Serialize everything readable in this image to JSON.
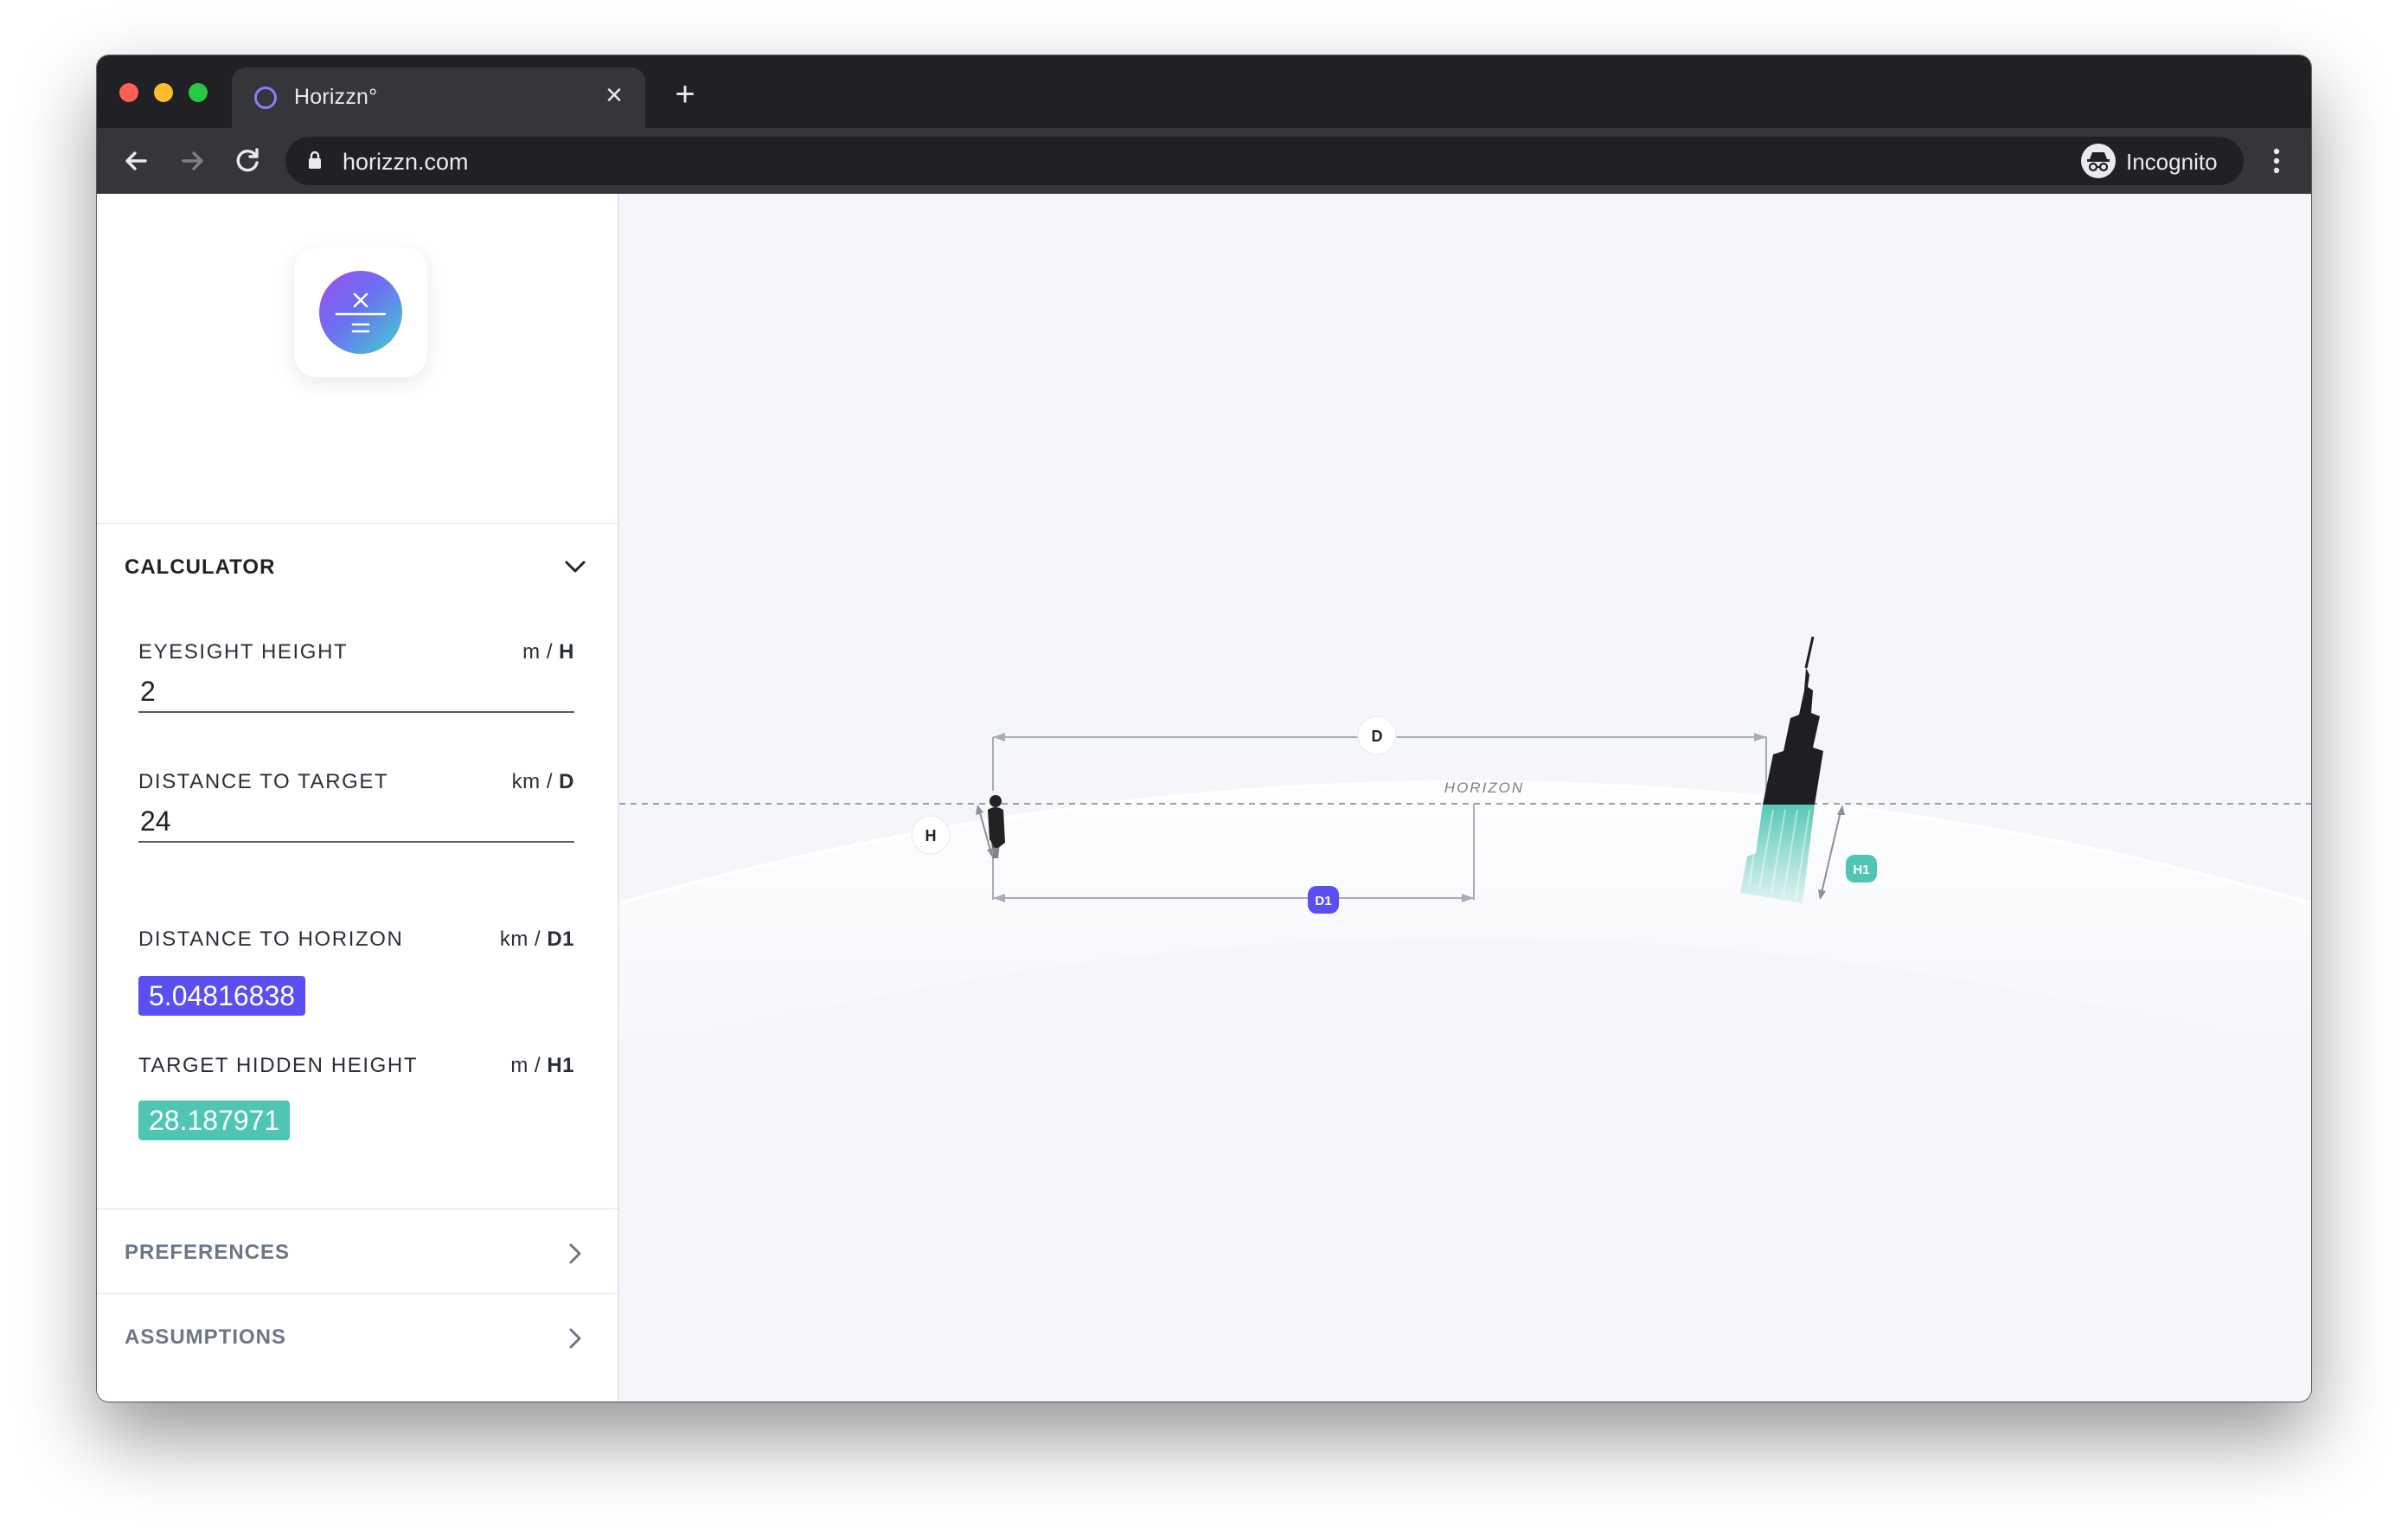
{
  "browser": {
    "tab_title": "Horizzn°",
    "url": "horizzn.com",
    "profile_label": "Incognito"
  },
  "sidebar": {
    "calculator_header": "CALCULATOR",
    "eyesight": {
      "label": "EYESIGHT HEIGHT",
      "unit": "m /",
      "symbol": "H",
      "value": "2"
    },
    "distance_target": {
      "label": "DISTANCE TO TARGET",
      "unit": "km /",
      "symbol": "D",
      "value": "24"
    },
    "distance_horizon": {
      "label": "DISTANCE TO HORIZON",
      "unit": "km /",
      "symbol": "D1",
      "value": "5.04816838"
    },
    "hidden_height": {
      "label": "TARGET HIDDEN HEIGHT",
      "unit": "m /",
      "symbol": "H1",
      "value": "28.187971"
    },
    "preferences_header": "PREFERENCES",
    "assumptions_header": "ASSUMPTIONS"
  },
  "diagram": {
    "horizon_label": "HORIZON",
    "badge_d": "D",
    "badge_h": "H",
    "badge_d1": "D1",
    "badge_h1": "H1"
  },
  "colors": {
    "accent_purple": "#5a4ff0",
    "accent_teal": "#4fc6b3",
    "chrome_dark": "#202124"
  }
}
